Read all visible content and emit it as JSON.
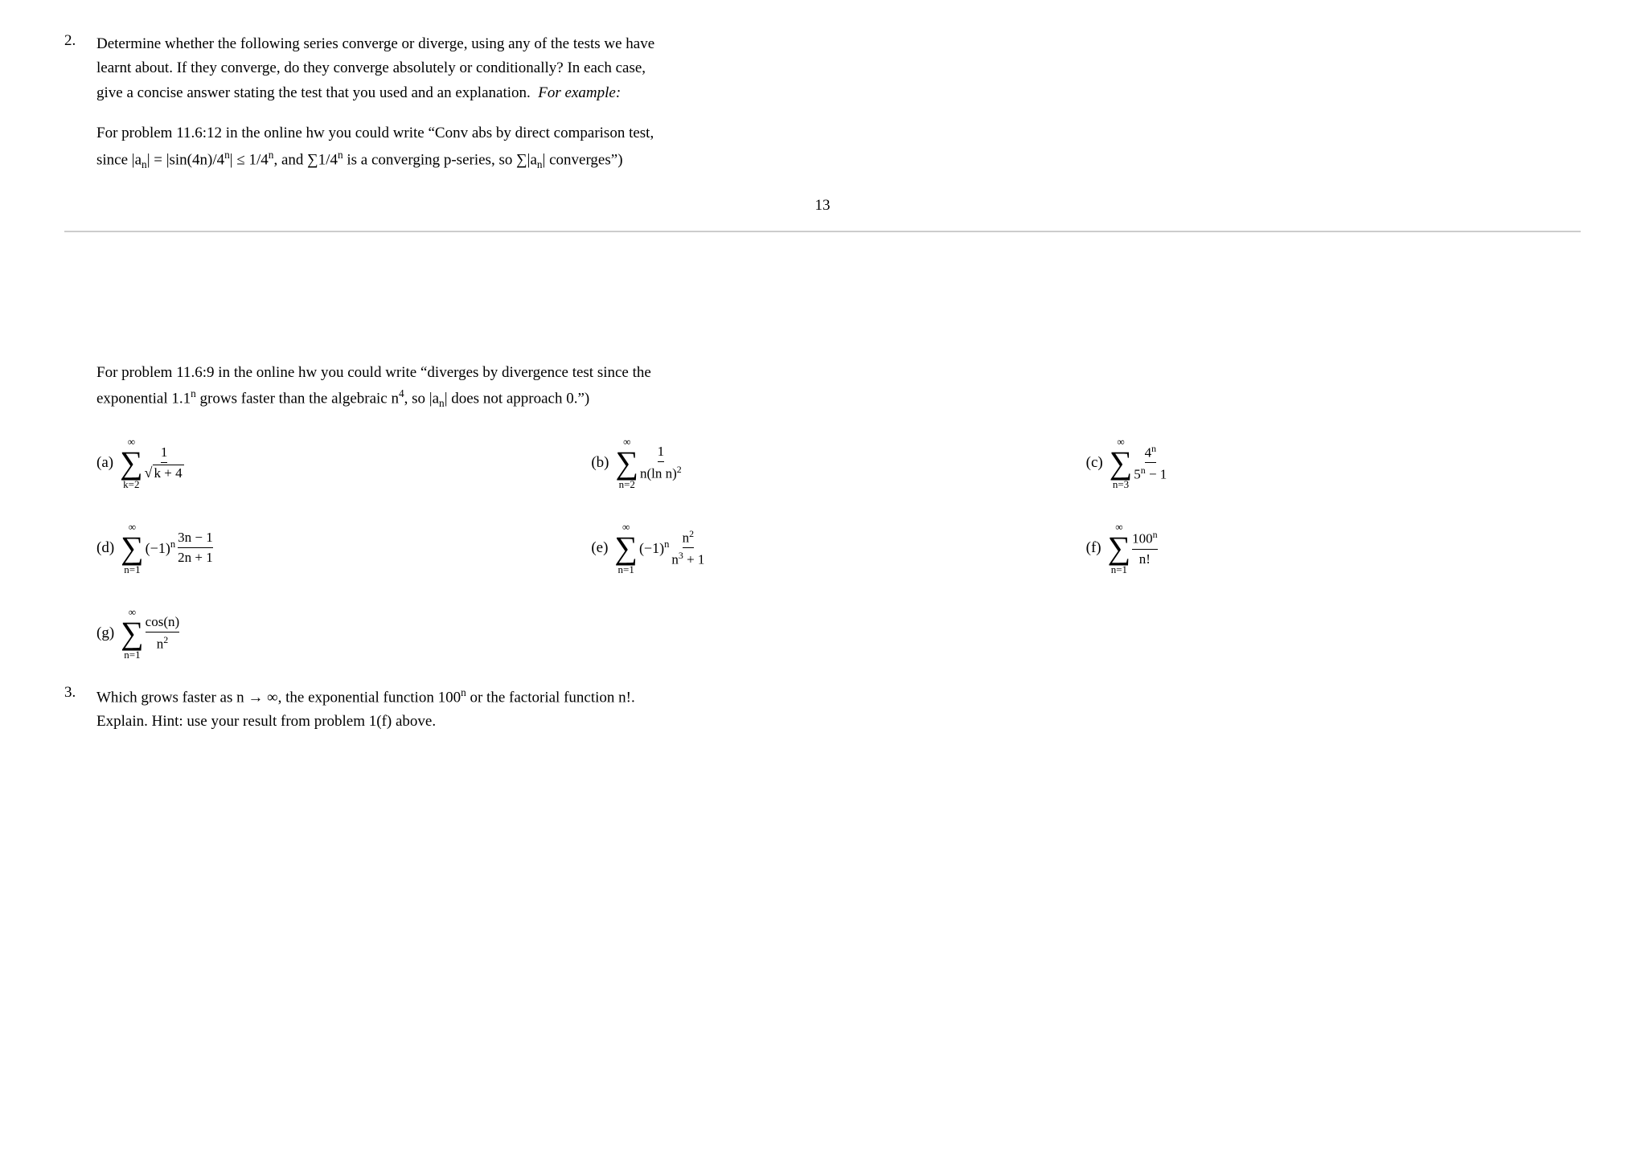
{
  "problem2": {
    "number": "2.",
    "text_line1": "Determine whether the following series converge or diverge, using any of the tests we have",
    "text_line2": "learnt about.  If they converge, do they converge absolutely or conditionally?  In each case,",
    "text_line3": "give a concise answer stating the test that you used and an explanation.",
    "italic_example": "For example:",
    "example_line1": "For problem 11.6:12 in the online hw you could write “Conv abs by direct comparison test,",
    "example_line2_part1": "since |a",
    "example_line2_n1": "n",
    "example_line2_part2": "| = |sin(4n)/4",
    "example_line2_n2": "n",
    "example_line2_part3": "| ≤ 1/4",
    "example_line2_n3": "n",
    "example_line2_part4": ", and Σ1/4",
    "example_line2_n4": "n",
    "example_line2_part5": " is a converging p-series, so Σ|a",
    "example_line2_n5": "n",
    "example_line2_part6": "| converges”)"
  },
  "page_number": "13",
  "example2": {
    "line1": "For problem 11.6:9 in the online hw you could write “diverges by divergence test since the",
    "line2_part1": "exponential 1.1",
    "line2_n": "n",
    "line2_part2": " grows faster than the algebraic n",
    "line2_n2": "4",
    "line2_part3": ", so |a",
    "line2_n3": "n",
    "line2_part4": "| does not approach 0.”)"
  },
  "series": {
    "a_label": "(a)",
    "a_sum_from": "k=2",
    "a_sum_to": "∞",
    "a_frac_num": "1",
    "a_frac_den": "√k + 4",
    "b_label": "(b)",
    "b_sum_from": "n=2",
    "b_sum_to": "∞",
    "b_frac_num": "1",
    "b_frac_den": "n(ln n)²",
    "c_label": "(c)",
    "c_sum_from": "n=3",
    "c_sum_to": "∞",
    "c_frac_num": "4ⁿ",
    "c_frac_den": "5ⁿ − 1",
    "d_label": "(d)",
    "d_sum_from": "n=1",
    "d_sum_to": "∞",
    "d_body": "(−1)ⁿ",
    "d_frac_num": "3n − 1",
    "d_frac_den": "2n + 1",
    "e_label": "(e)",
    "e_sum_from": "n=1",
    "e_sum_to": "∞",
    "e_body": "(−1)ⁿ",
    "e_frac_num": "n²",
    "e_frac_den": "n³ + 1",
    "f_label": "(f)",
    "f_sum_from": "n=1",
    "f_sum_to": "∞",
    "f_frac_num": "100ⁿ",
    "f_frac_den": "n!",
    "g_label": "(g)",
    "g_sum_from": "n=1",
    "g_sum_to": "∞",
    "g_frac_num": "cos(n)",
    "g_frac_den": "n²"
  },
  "problem3": {
    "number": "3.",
    "text_line1": "Which grows faster as n → ∞, the exponential function 100ⁿ or the factorial function n!.",
    "text_line2": "Explain. Hint: use your result from problem 1(f) above."
  }
}
